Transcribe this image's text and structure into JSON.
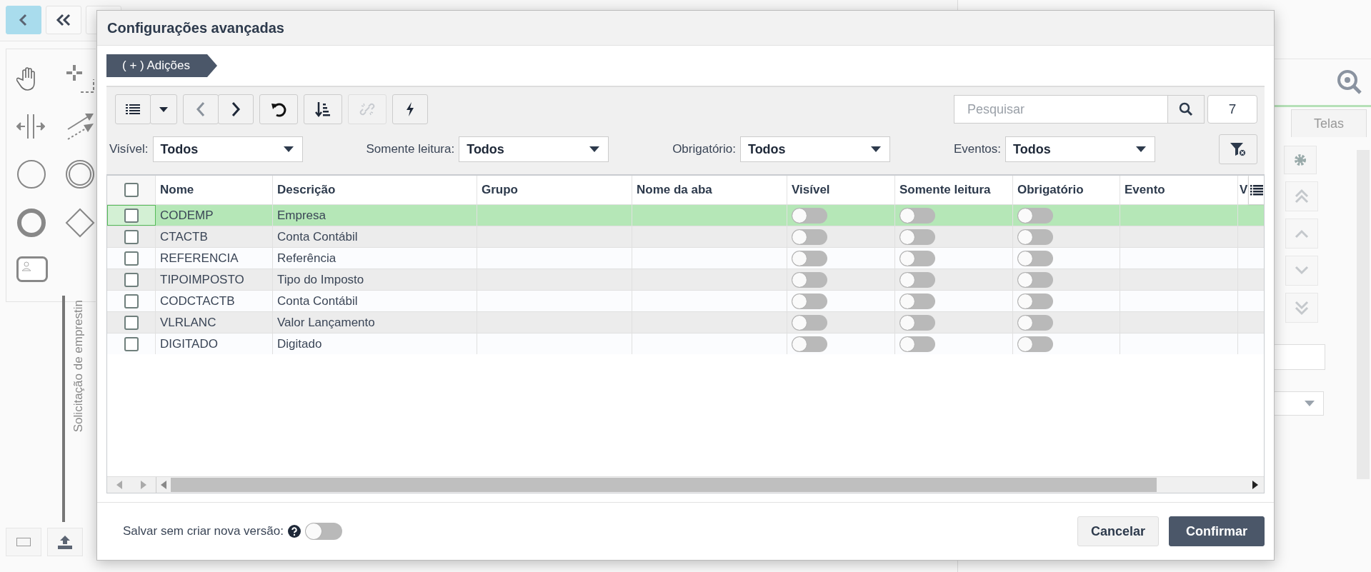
{
  "background": {
    "vertical_label": "Solicitação de emprestin",
    "right_tab": "Telas"
  },
  "dialog": {
    "title": "Configurações avançadas",
    "breadcrumb": "( + ) Adições",
    "toolbar": [
      [
        {
          "kind": "list",
          "disabled": false
        },
        {
          "kind": "dropdown",
          "disabled": false
        }
      ],
      [
        {
          "kind": "prev",
          "disabled": false
        },
        {
          "kind": "next",
          "disabled": false
        }
      ],
      [
        {
          "kind": "undo",
          "disabled": false
        }
      ],
      [
        {
          "kind": "sort",
          "disabled": false
        }
      ],
      [
        {
          "kind": "unlink",
          "disabled": true
        }
      ],
      [
        {
          "kind": "action",
          "disabled": false
        }
      ]
    ],
    "search": {
      "placeholder": "Pesquisar"
    },
    "count": "7",
    "filters": [
      {
        "label": "Visível:",
        "value": "Todos"
      },
      {
        "label": "Somente leitura:",
        "value": "Todos"
      },
      {
        "label": "Obrigatório:",
        "value": "Todos"
      },
      {
        "label": "Eventos:",
        "value": "Todos"
      }
    ],
    "table": {
      "all_checked": false,
      "columns": [
        "Nome",
        "Descrição",
        "Grupo",
        "Nome da aba",
        "Visível",
        "Somente leitura",
        "Obrigatório",
        "Evento",
        "V"
      ],
      "rows": [
        {
          "selected": true,
          "checked": false,
          "nome": "CODEMP",
          "descricao": "Empresa",
          "visivel": false,
          "somente_leitura": false,
          "obrigatorio": false
        },
        {
          "selected": false,
          "checked": false,
          "nome": "CTACTB",
          "descricao": "Conta Contábil",
          "visivel": false,
          "somente_leitura": false,
          "obrigatorio": false
        },
        {
          "selected": false,
          "checked": false,
          "nome": "REFERENCIA",
          "descricao": "Referência",
          "visivel": false,
          "somente_leitura": false,
          "obrigatorio": false
        },
        {
          "selected": false,
          "checked": false,
          "nome": "TIPOIMPOSTO",
          "descricao": "Tipo do Imposto",
          "visivel": false,
          "somente_leitura": false,
          "obrigatorio": false
        },
        {
          "selected": false,
          "checked": false,
          "nome": "CODCTACTB",
          "descricao": "Conta Contábil",
          "visivel": false,
          "somente_leitura": false,
          "obrigatorio": false
        },
        {
          "selected": false,
          "checked": false,
          "nome": "VLRLANC",
          "descricao": "Valor Lançamento",
          "visivel": false,
          "somente_leitura": false,
          "obrigatorio": false
        },
        {
          "selected": false,
          "checked": false,
          "nome": "DIGITADO",
          "descricao": "Digitado",
          "visivel": false,
          "somente_leitura": false,
          "obrigatorio": false
        }
      ]
    },
    "footer": {
      "save_label": "Salvar sem criar nova versão:",
      "save_without_version": false,
      "buttons": [
        {
          "label": "Cancelar",
          "kind": "secondary"
        },
        {
          "label": "Confirmar",
          "kind": "primary"
        }
      ]
    }
  }
}
